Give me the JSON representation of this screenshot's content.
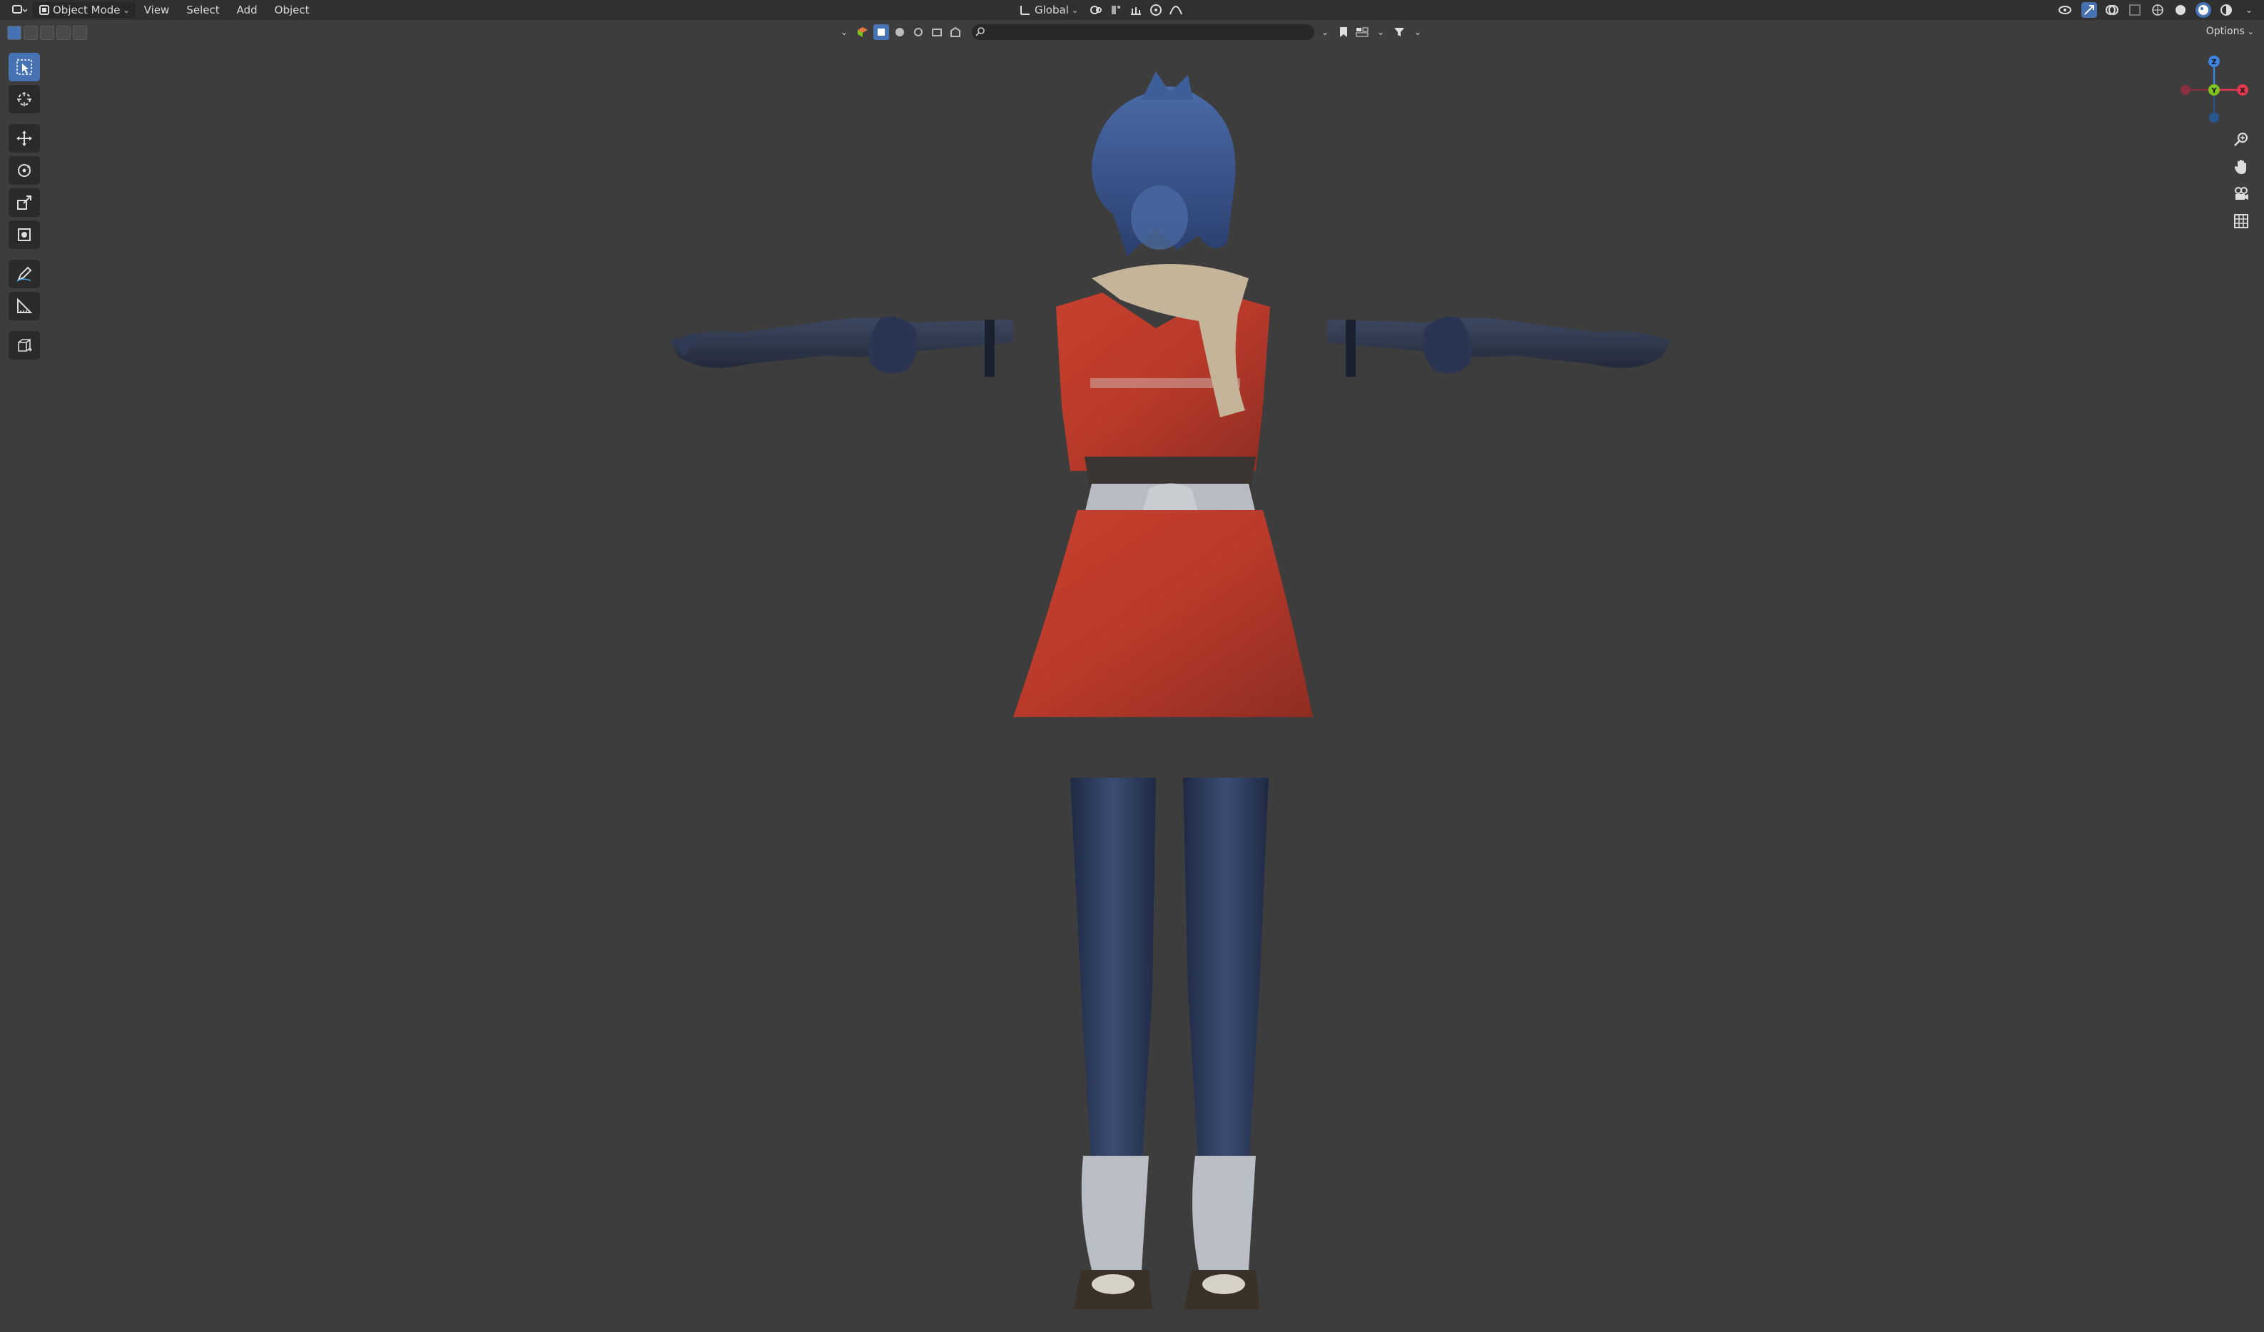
{
  "header": {
    "mode_label": "Object Mode",
    "menus": [
      "View",
      "Select",
      "Add",
      "Object"
    ],
    "transform_orientation": "Global"
  },
  "subheader": {
    "options_label": "Options"
  },
  "gizmo": {
    "x_label": "X",
    "y_label": "Y",
    "z_label": "Z"
  },
  "colors": {
    "accent": "#4772b3",
    "axis_x": "#e0384e",
    "axis_y": "#7ec31f",
    "axis_z": "#3b85e0"
  }
}
